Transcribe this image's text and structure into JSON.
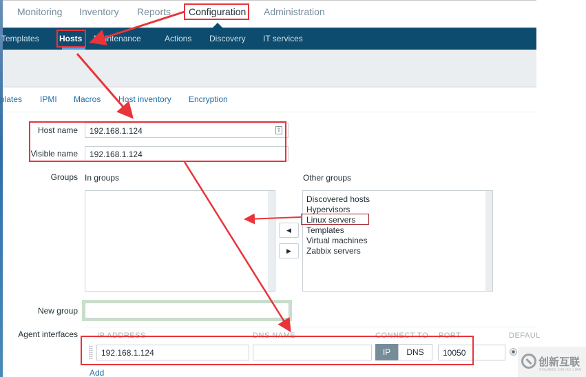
{
  "top_nav": {
    "items": [
      "Monitoring",
      "Inventory",
      "Reports",
      "Configuration",
      "Administration"
    ],
    "active": "Configuration"
  },
  "sub_nav": {
    "items": [
      "Templates",
      "Hosts",
      "Maintenance",
      "Actions",
      "Discovery",
      "IT services"
    ],
    "active": "Hosts"
  },
  "tabs": [
    "plates",
    "IPMI",
    "Macros",
    "Host inventory",
    "Encryption"
  ],
  "form": {
    "host_name_label": "Host name",
    "host_name_value": "192.168.1.124",
    "visible_name_label": "Visible name",
    "visible_name_value": "192.168.1.124",
    "groups_label": "Groups",
    "in_groups_label": "In groups",
    "in_groups": [],
    "other_groups_label": "Other groups",
    "other_groups": [
      "Discovered hosts",
      "Hypervisors",
      "Linux servers",
      "Templates",
      "Virtual machines",
      "Zabbix servers"
    ],
    "move_left_glyph": "◀",
    "move_right_glyph": "▶",
    "new_group_label": "New group",
    "new_group_value": "",
    "agent_interfaces_label": "Agent interfaces",
    "interface_headers": {
      "ip": "IP ADDRESS",
      "dns": "DNS NAME",
      "connect_to": "CONNECT TO",
      "port": "PORT",
      "default": "DEFAUL"
    },
    "interface": {
      "ip": "192.168.1.124",
      "dns": "",
      "connect_ip_label": "IP",
      "connect_dns_label": "DNS",
      "connect_selected": "IP",
      "port": "10050",
      "default": true
    },
    "add_link": "Add"
  },
  "annotation_color": "#e8343a",
  "watermark": {
    "text": "创新互联",
    "subtext": "CHUANG XIN HU LIAN"
  }
}
